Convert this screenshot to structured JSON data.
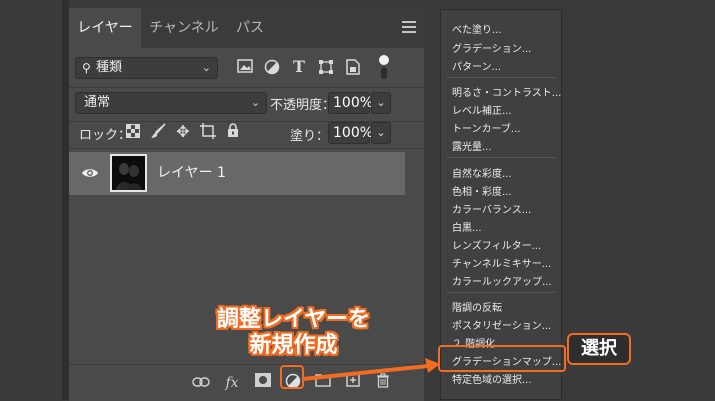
{
  "panel": {
    "tabs": [
      {
        "label": "レイヤー"
      },
      {
        "label": "チャンネル"
      },
      {
        "label": "パス"
      }
    ],
    "filter": {
      "label": "種類"
    },
    "blend_mode": "通常",
    "opacity_label": "不透明度：",
    "opacity_value": "100%",
    "lock_label": "ロック：",
    "fill_label": "塗り：",
    "fill_value": "100%",
    "layer": {
      "name": "レイヤー 1"
    },
    "bottom_fx": "fx"
  },
  "menu": {
    "items": [
      "べた塗り...",
      "グラデーション...",
      "パターン...",
      "明るさ・コントラスト...",
      "レベル補正...",
      "トーンカーブ...",
      "露光量...",
      "自然な彩度...",
      "色相・彩度...",
      "カラーバランス...",
      "白黒...",
      "レンズフィルター...",
      "チャンネルミキサー...",
      "カラールックアップ...",
      "階調の反転",
      "ポスタリゼーション...",
      "２ 階調化...",
      "グラデーションマップ...",
      "特定色域の選択..."
    ]
  },
  "annotations": {
    "create_line1": "調整レイヤーを",
    "create_line2": "新規作成",
    "select": "選択",
    "accent_color": "#f26c21"
  }
}
